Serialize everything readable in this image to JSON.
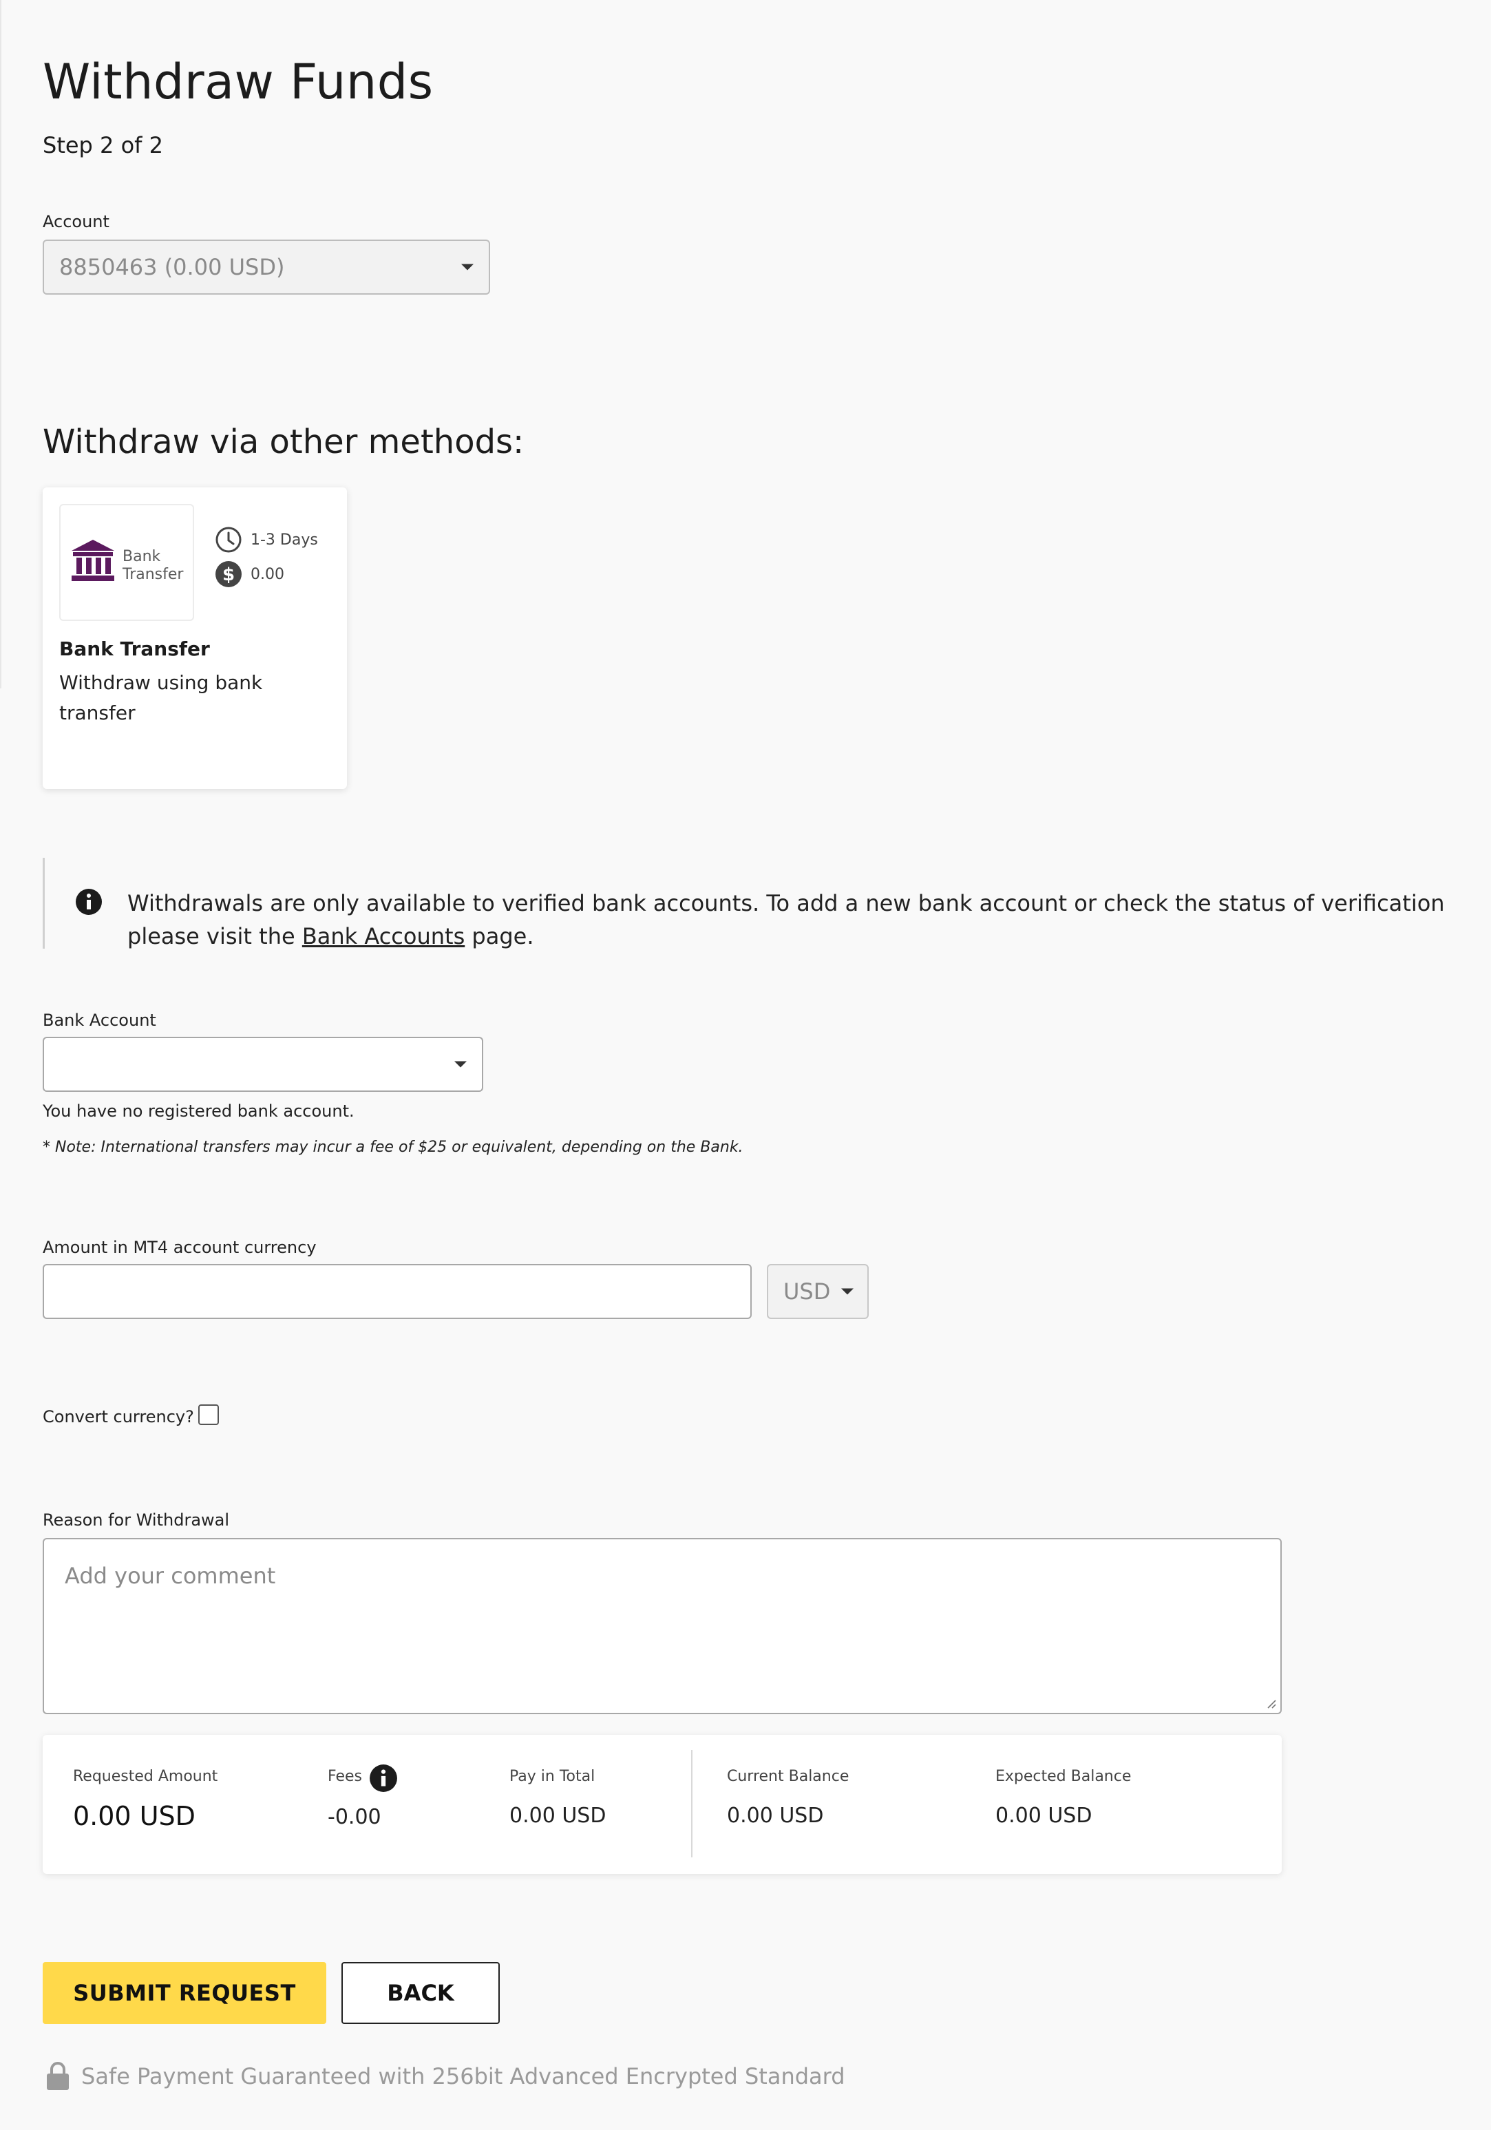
{
  "page": {
    "title": "Withdraw Funds",
    "step": "Step 2 of 2"
  },
  "account": {
    "label": "Account",
    "value": "8850463 (0.00 USD)"
  },
  "methods": {
    "title": "Withdraw via other methods:",
    "items": [
      {
        "logo_line1": "Bank",
        "logo_line2": "Transfer",
        "logo_icon": "bank-building-icon",
        "duration": "1-3 Days",
        "fee": "0.00",
        "name": "Bank Transfer",
        "description": "Withdraw using bank transfer"
      }
    ]
  },
  "info": {
    "text_before": "Withdrawals are only available to verified bank accounts. To add a new bank account or check the status of verification please visit the ",
    "link": "Bank Accounts",
    "text_after": " page."
  },
  "bank_account": {
    "label": "Bank Account",
    "value": "",
    "hint": "You have no registered bank account.",
    "note": "* Note: International transfers may incur a fee of $25 or equivalent, depending on the Bank."
  },
  "amount": {
    "label": "Amount in MT4 account currency",
    "value": "",
    "currency": "USD"
  },
  "convert": {
    "label": "Convert currency?",
    "checked": false
  },
  "reason": {
    "label": "Reason for Withdrawal",
    "placeholder": "Add your comment"
  },
  "summary": {
    "requested_label": "Requested Amount",
    "requested_value": "0.00 USD",
    "fees_label": "Fees",
    "fees_value": "-0.00",
    "total_label": "Pay in Total",
    "total_value": "0.00 USD",
    "current_label": "Current Balance",
    "current_value": "0.00 USD",
    "expected_label": "Expected Balance",
    "expected_value": "0.00 USD"
  },
  "actions": {
    "submit": "SUBMIT REQUEST",
    "back": "BACK"
  },
  "footer": {
    "secure_text": "Safe Payment Guaranteed with 256bit Advanced Encrypted Standard"
  },
  "colors": {
    "accent": "#ffd94a",
    "bank_logo": "#5b1a5e"
  }
}
